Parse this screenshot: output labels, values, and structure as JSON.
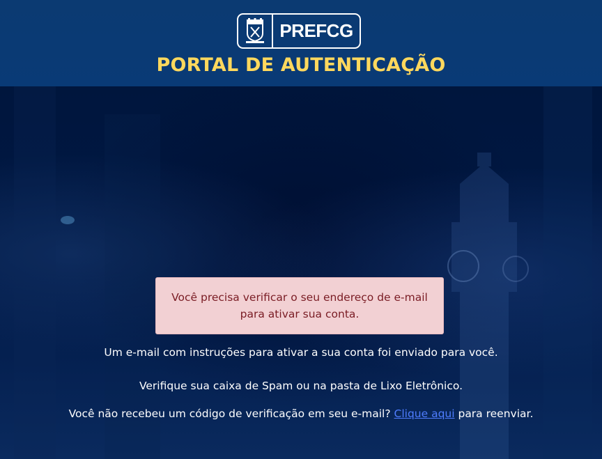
{
  "header": {
    "logo": {
      "text_pref": "PREF",
      "text_cg": "CG",
      "crest_icon": "city-crest-icon"
    },
    "portal_title": "PORTAL DE AUTENTICAÇÃO"
  },
  "alert": {
    "line1": "Você precisa verificar o seu endereço de e-mail",
    "line2": "para ativar sua conta."
  },
  "messages": {
    "sent": "Um e-mail com instruções para ativar a sua conta foi enviado para você.",
    "spam": "Verifique sua caixa de Spam ou na pasta de Lixo Eletrônico.",
    "resend_prefix": "Você não recebeu um código de verificação em seu e-mail? ",
    "resend_link": "Clique aqui",
    "resend_suffix": " para reenviar."
  },
  "colors": {
    "header_bg": "#0b3a72",
    "title": "#ffd85d",
    "alert_bg": "#f2d0d3",
    "alert_text": "#7a1c24",
    "link": "#4f7dff",
    "page_bg": "#001a44"
  }
}
